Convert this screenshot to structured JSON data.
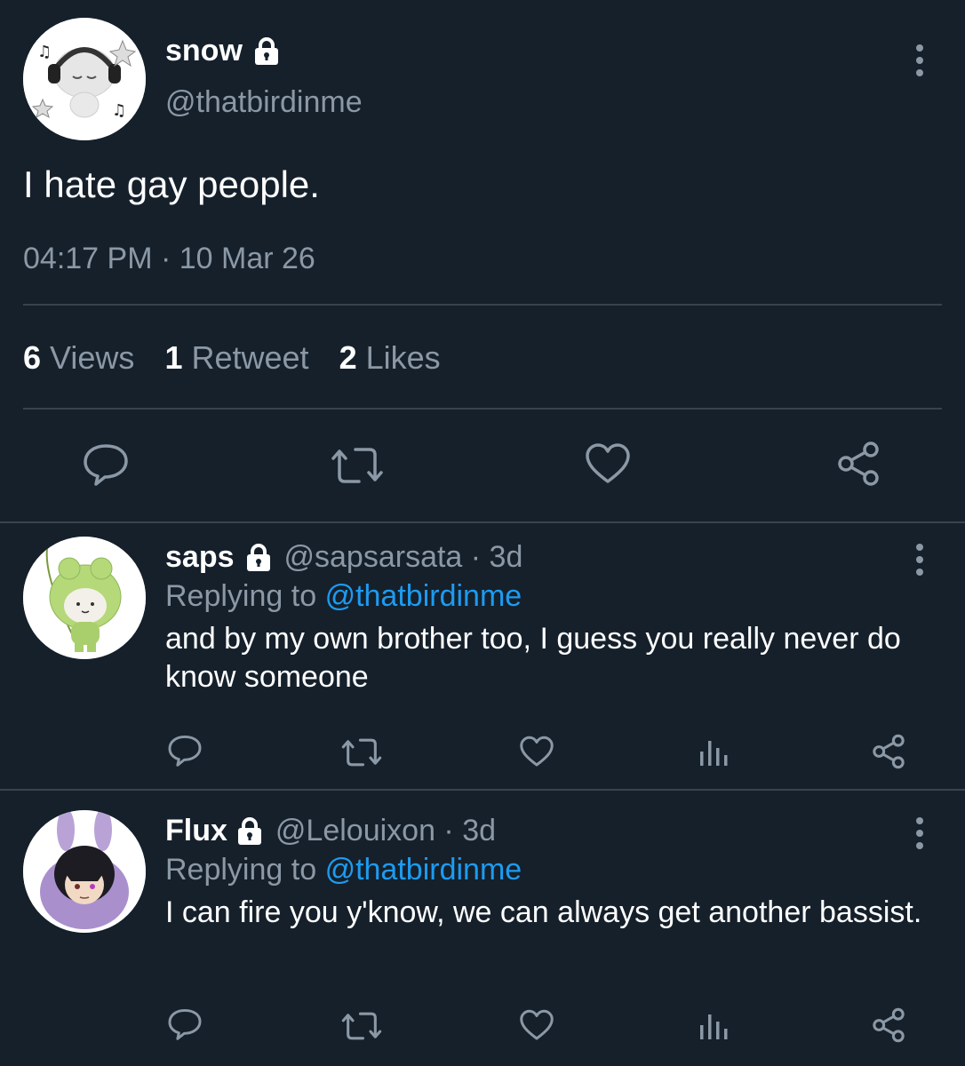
{
  "main": {
    "name": "snow",
    "handle": "@thatbirdinme",
    "text": "I hate gay people.",
    "timestamp": "04:17 PM · 10 Mar 26",
    "views_count": "6",
    "views_label": "Views",
    "retweets_count": "1",
    "retweets_label": "Retweet",
    "likes_count": "2",
    "likes_label": "Likes"
  },
  "replies": [
    {
      "name": "saps",
      "handle_time": "@sapsarsata · 3d",
      "replying_prefix": "Replying to",
      "replying_handle": "@thatbirdinme",
      "text": "and by my own brother too, I guess you really never do know someone"
    },
    {
      "name": "Flux",
      "handle_time": "@Lelouixon · 3d",
      "replying_prefix": "Replying to",
      "replying_handle": "@thatbirdinme",
      "text": "I can fire you y'know, we can always get another bassist."
    }
  ],
  "colors": {
    "background": "#15202b",
    "secondary_text": "#8b98a5",
    "link": "#1d9bf0",
    "divider": "#38444d"
  },
  "icons": [
    "lock-icon",
    "more-icon",
    "reply-icon",
    "retweet-icon",
    "like-icon",
    "share-icon",
    "analytics-icon"
  ]
}
